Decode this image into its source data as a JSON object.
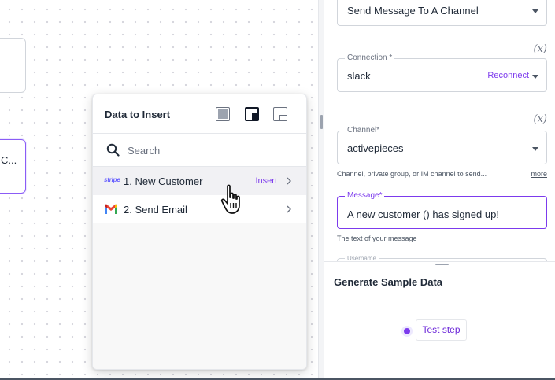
{
  "canvas": {
    "selected_node_text": "C..."
  },
  "data_popup": {
    "title": "Data to Insert",
    "layout_buttons": [
      "layout-full-icon",
      "layout-dock-right-icon",
      "layout-dock-bottom-icon"
    ],
    "search": {
      "placeholder": "Search",
      "value": ""
    },
    "items": [
      {
        "icon": "stripe-icon",
        "icon_text": "stripe",
        "label": "1. New Customer",
        "action": "Insert"
      },
      {
        "icon": "gmail-icon",
        "label": "2. Send Email"
      }
    ]
  },
  "right_panel": {
    "action_field": {
      "value": "Send Message To A Channel"
    },
    "var_toggle": "(x)",
    "connection_field": {
      "legend": "Connection *",
      "value": "slack",
      "action": "Reconnect"
    },
    "channel_field": {
      "legend": "Channel*",
      "value": "activepieces",
      "help": "Channel, private group, or IM channel to send...",
      "more": "more"
    },
    "message_field": {
      "legend": "Message*",
      "value": "A new customer () has signed up!",
      "help": "The text of your message"
    },
    "username_field": {
      "legend": "Username"
    },
    "sample_section": {
      "title": "Generate Sample Data",
      "button": "Test step"
    }
  },
  "colors": {
    "accent": "#7c3aed",
    "border": "#d1d5db",
    "stripe": "#635bff"
  }
}
